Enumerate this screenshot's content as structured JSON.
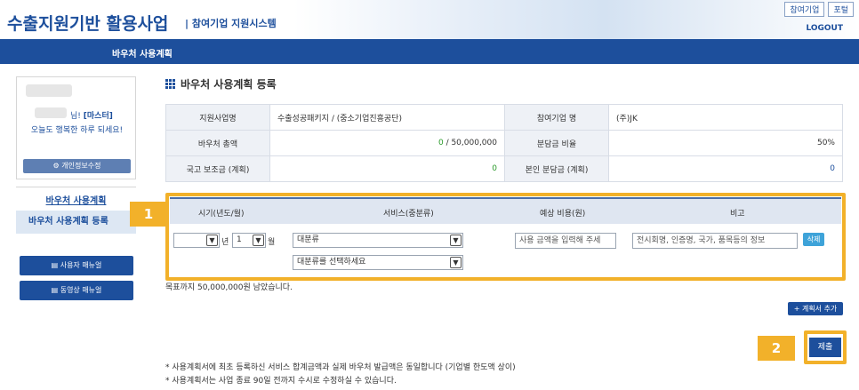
{
  "header": {
    "logo": "수출지원기반 활용사업",
    "logo_sub": "| 참여기업 지원시스템",
    "links": [
      "참여기업",
      "포털"
    ],
    "logout": "LOGOUT",
    "nav_item": "바우처 사용계획"
  },
  "sidebar": {
    "greeting_suffix": "님!",
    "role": "[마스터]",
    "greeting_line2": "오늘도 행복한 하루 되세요!",
    "edit_profile": "개인정보수정",
    "menu_title": "바우처 사용계획",
    "menu_active": "바우처 사용계획 등록",
    "user_manual": "사용자 매뉴얼",
    "video_manual": "동영상 매뉴얼"
  },
  "main": {
    "title": "바우처 사용계획 등록",
    "info": {
      "program_label": "지원사업명",
      "program_value": "수출성공패키지 / (중소기업진흥공단)",
      "company_label": "참여기업 명",
      "company_value": "(주)JK",
      "voucher_label": "바우처 총액",
      "voucher_used": "0",
      "voucher_total": " / 50,000,000",
      "share_label": "분담금 비율",
      "share_value": "50%",
      "subsidy_label": "국고 보조금 (계획)",
      "subsidy_value": "0",
      "self_label": "본인 분담금 (계획)",
      "self_value": "0"
    },
    "plan": {
      "col_period": "시기(년도/월)",
      "col_service": "서비스(중분류)",
      "col_cost": "예상 비용(원)",
      "col_note": "비고",
      "year_value": "",
      "year_suffix": "년",
      "month_value": "1",
      "month_suffix": "월",
      "category_value": "대분류",
      "subcategory_value": "대분류를 선택하세요",
      "cost_placeholder": "사용 금액을 입력해 주세",
      "note_placeholder": "전시회명, 인증명, 국가, 품목등의 정보",
      "delete": "삭제"
    },
    "remaining": "목표까지 50,000,000원 남았습니다.",
    "add_plan": "계획서 추가",
    "submit": "제출",
    "notes": [
      "* 사용계획서에 최초 등록하신 서비스 합계금액과 실제 바우처 발급액은 동일합니다 (기업별 한도액 상이)",
      "* 사용계획서는 사업 종료 90일 전까지 수시로 수정하실 수 있습니다."
    ]
  },
  "annotations": {
    "badge1": "1",
    "badge2": "2"
  },
  "colors": {
    "brand": "#1d4f9c",
    "highlight": "#f2b12a",
    "delete_button": "#3ea3d9"
  }
}
